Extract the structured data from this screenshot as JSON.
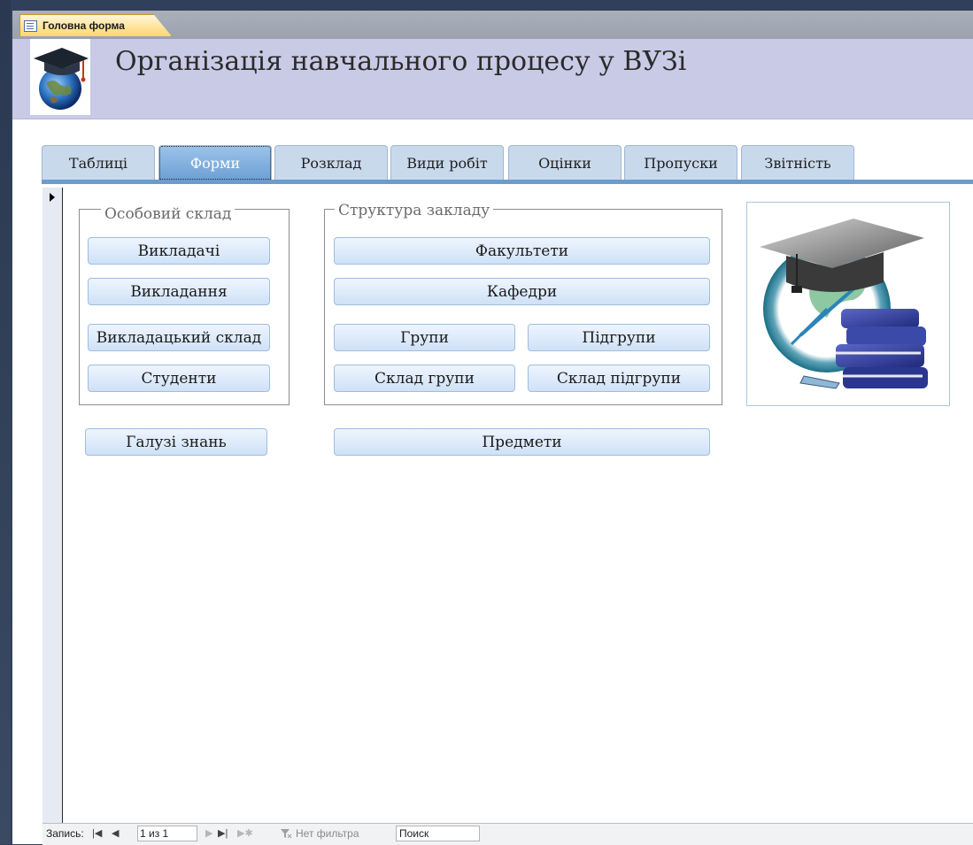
{
  "document_tab": {
    "title": "Головна форма",
    "icon": "form-icon"
  },
  "header": {
    "title": "Організація навчального процесу у ВУЗі",
    "logo": "graduation-globe-logo"
  },
  "tabs": [
    {
      "label": "Таблиці"
    },
    {
      "label": "Форми",
      "active": true
    },
    {
      "label": "Розклад"
    },
    {
      "label": "Види робіт"
    },
    {
      "label": "Оцінки"
    },
    {
      "label": "Пропуски"
    },
    {
      "label": "Звітність"
    }
  ],
  "groups": {
    "personnel": {
      "title": "Особовий склад",
      "buttons": [
        "Викладачі",
        "Викладання",
        "Викладацький склад",
        "Студенти"
      ]
    },
    "structure": {
      "title": "Структура закладу",
      "buttons": [
        "Факультети",
        "Кафедри",
        "Групи",
        "Підгрупи",
        "Склад групи",
        "Склад підгрупи"
      ]
    }
  },
  "extra_buttons": {
    "fields": "Галузі знань",
    "subjects": "Предмети"
  },
  "picture": "education-clipart",
  "status_bar": {
    "record_label": "Запись:",
    "record_value": "1 из 1",
    "filter": "Нет фильтра",
    "search": "Поиск"
  },
  "colors": {
    "header_bg": "#c9cae6",
    "tab_active": "#6c9fd4",
    "tab_inactive": "#c9d9ec",
    "document_tab": "#ffd66e"
  }
}
